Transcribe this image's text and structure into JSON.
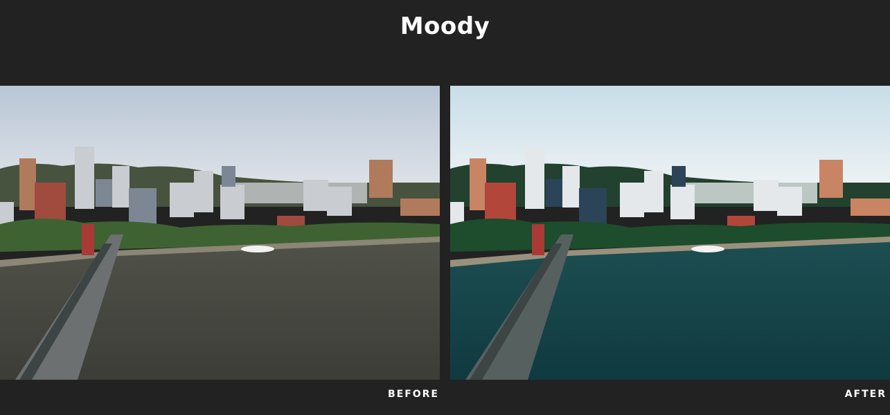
{
  "title": "Moody",
  "labels": {
    "before": "BEFORE",
    "after": "AFTER"
  },
  "palettes": {
    "before": {
      "sky_top": "#b9c6d6",
      "sky_bottom": "#dfe3e8",
      "hills": "#47523f",
      "water_top": "#505249",
      "water_bottom": "#3c3d37",
      "trees": "#3f6233",
      "tower_light": "#c9ccd0",
      "tower_dark": "#7d8794",
      "brick": "#a04b3e",
      "tan": "#b07a5c",
      "bank": "#8c8676",
      "bridge": "#6c7070"
    },
    "after": {
      "sky_top": "#c8dde8",
      "sky_bottom": "#eef3f5",
      "hills": "#22412f",
      "water_top": "#1d4e52",
      "water_bottom": "#0f3a3f",
      "trees": "#1d4d2c",
      "tower_light": "#e4e8ea",
      "tower_dark": "#2c4458",
      "brick": "#b2463b",
      "tan": "#c98463",
      "bank": "#9a917d",
      "bridge": "#56605f"
    }
  }
}
